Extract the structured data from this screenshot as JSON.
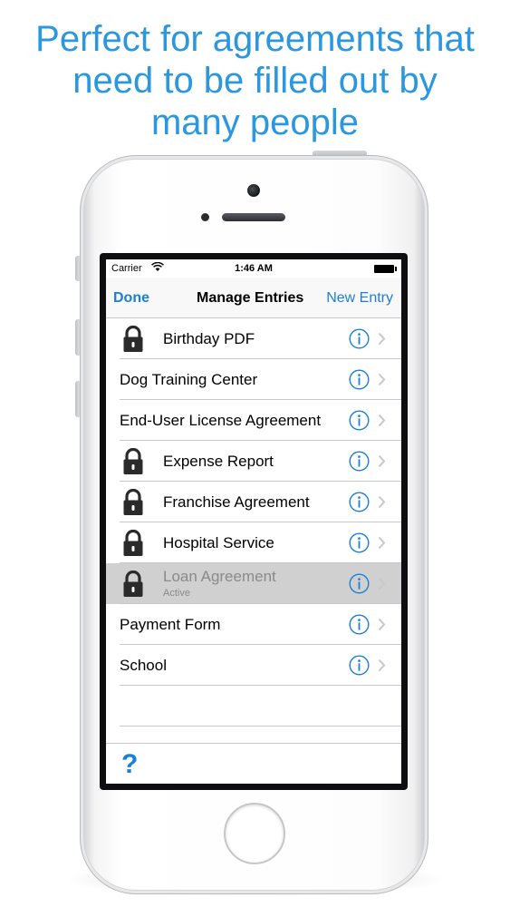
{
  "headline": {
    "line1": "Perfect for agreements that",
    "line2": "need to be filled out by",
    "line3": "many people"
  },
  "status_bar": {
    "carrier": "Carrier",
    "time": "1:46 AM"
  },
  "nav": {
    "left": "Done",
    "title": "Manage Entries",
    "right": "New Entry"
  },
  "entries": [
    {
      "label": "Birthday PDF",
      "locked": true,
      "subtitle": ""
    },
    {
      "label": "Dog Training Center",
      "locked": false,
      "subtitle": ""
    },
    {
      "label": "End-User License Agreement",
      "locked": false,
      "subtitle": ""
    },
    {
      "label": "Expense Report",
      "locked": true,
      "subtitle": ""
    },
    {
      "label": "Franchise Agreement",
      "locked": true,
      "subtitle": ""
    },
    {
      "label": "Hospital Service",
      "locked": true,
      "subtitle": ""
    },
    {
      "label": "Loan Agreement",
      "locked": true,
      "subtitle": "Active"
    },
    {
      "label": "Payment Form",
      "locked": false,
      "subtitle": ""
    },
    {
      "label": "School",
      "locked": false,
      "subtitle": ""
    }
  ],
  "toolbar": {
    "help": "?"
  },
  "colors": {
    "headline": "#2a97de",
    "tint": "#1a7fd6",
    "active_row": "#d0d0d0"
  },
  "icons": [
    "lock-icon",
    "info-icon",
    "chevron-right-icon",
    "wifi-icon",
    "battery-icon",
    "help-icon"
  ]
}
